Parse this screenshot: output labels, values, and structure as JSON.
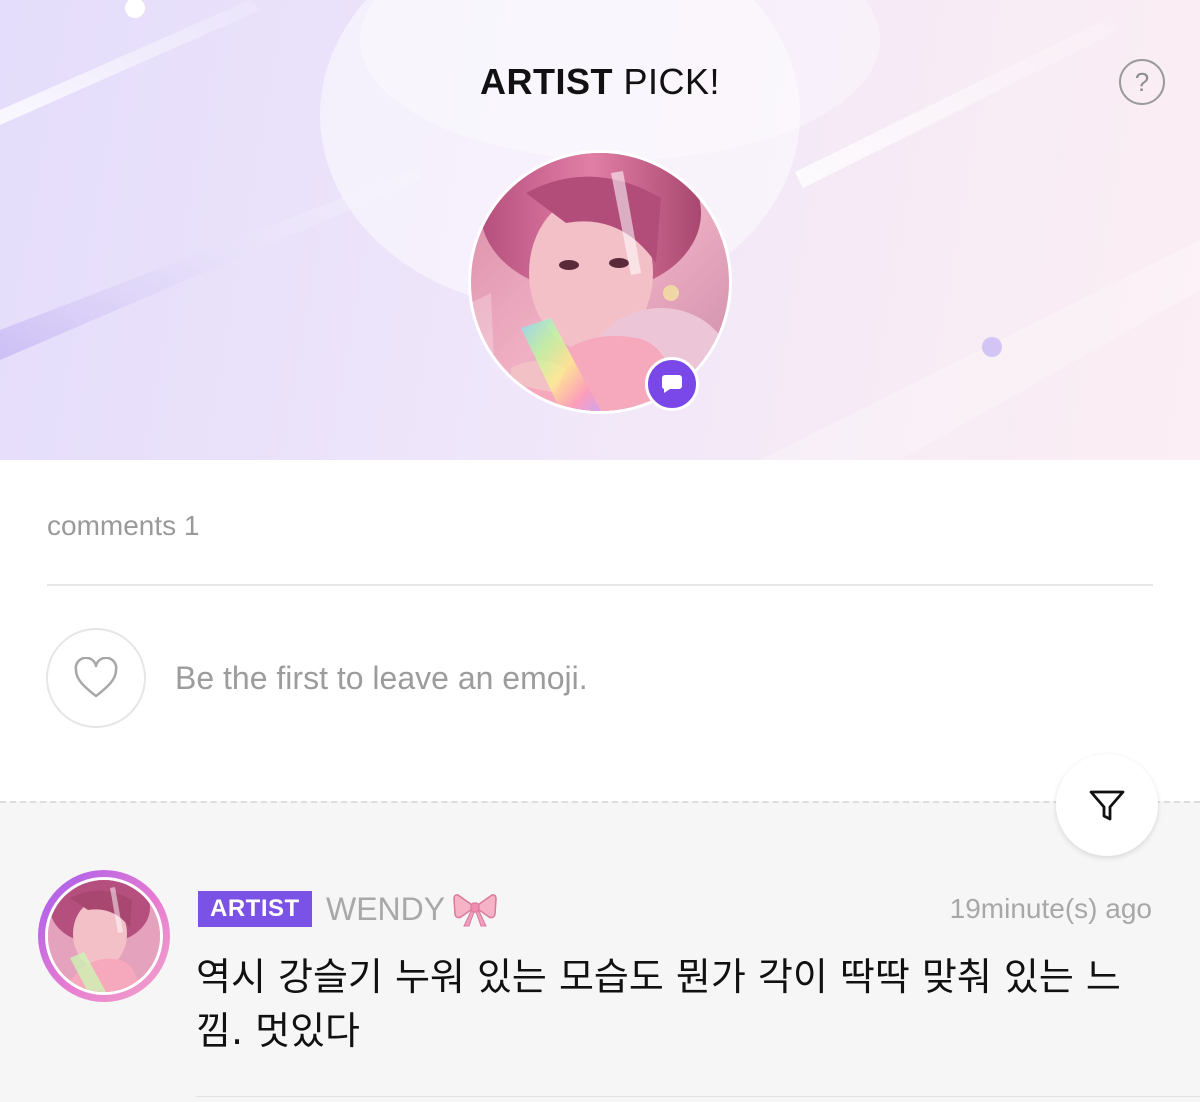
{
  "header": {
    "title_bold": "ARTIST",
    "title_light": "PICK!",
    "help_label": "?"
  },
  "comments": {
    "count_label": "comments 1"
  },
  "emoji": {
    "prompt": "Be the first to leave an emoji."
  },
  "comment_list": {
    "items": [
      {
        "badge": "ARTIST",
        "author": "WENDY",
        "author_emoji_icon": "ribbon-bow-icon",
        "time": "19minute(s) ago",
        "text": "역시 강슬기 누워 있는 모습도 뭔가 각이 딱딱 맞춰 있는 느낌. 멋있다"
      }
    ]
  },
  "icons": {
    "help": "question-mark-icon",
    "chat_badge": "chat-bubble-icon",
    "emoji": "heart-icon",
    "filter": "filter-funnel-icon"
  },
  "colors": {
    "accent": "#7a48e8",
    "badge": "#7a52e6",
    "title_highlight": "#d6cbf7",
    "muted_text": "#9a9a9a"
  }
}
